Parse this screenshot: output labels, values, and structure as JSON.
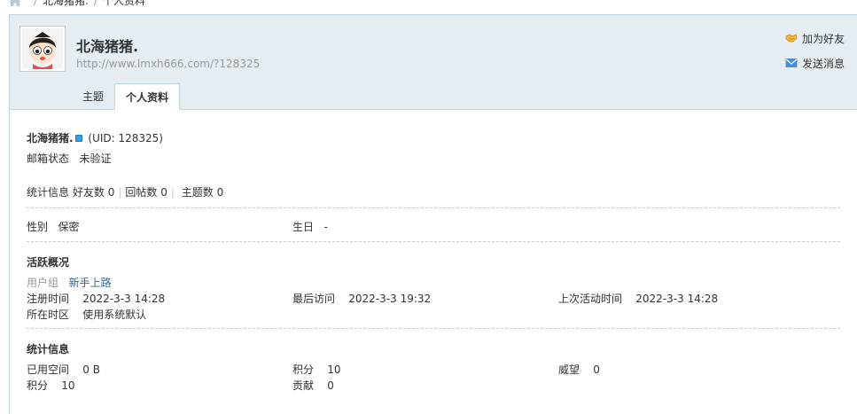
{
  "breadcrumb": {
    "user": "北海猪猪.",
    "sep": "/",
    "current": "个人资料"
  },
  "header": {
    "username": "北海猪猪.",
    "url": "http://www.lmxh666.com/?128325",
    "add_friend": "加为好友",
    "send_message": "发送消息"
  },
  "tabs": [
    {
      "label": "主题"
    },
    {
      "label": "个人资料"
    }
  ],
  "profile": {
    "name": "北海猪猪.",
    "uid": "(UID: 128325)",
    "email_label": "邮箱状态",
    "email_value": "未验证",
    "stats_label": "统计信息",
    "friends_label": "好友数",
    "friends_value": "0",
    "replies_label": "回帖数",
    "replies_value": "0",
    "threads_label": "主题数",
    "threads_value": "0",
    "gender_label": "性别",
    "gender_value": "保密",
    "birthday_label": "生日",
    "birthday_value": "-"
  },
  "activity": {
    "title": "活跃概况",
    "group_label": "用户组",
    "group_value": "新手上路",
    "reg_label": "注册时间",
    "reg_value": "2022-3-3 14:28",
    "last_visit_label": "最后访问",
    "last_visit_value": "2022-3-3 19:32",
    "last_active_label": "上次活动时间",
    "last_active_value": "2022-3-3 14:28",
    "tz_label": "所在时区",
    "tz_value": "使用系统默认"
  },
  "stats": {
    "title": "统计信息",
    "space_label": "已用空间",
    "space_value": "0 B",
    "credits_label": "积分",
    "credits_value": "10",
    "prestige_label": "威望",
    "prestige_value": "0",
    "points_label": "积分",
    "points_value": "10",
    "contrib_label": "贡献",
    "contrib_value": "0"
  }
}
